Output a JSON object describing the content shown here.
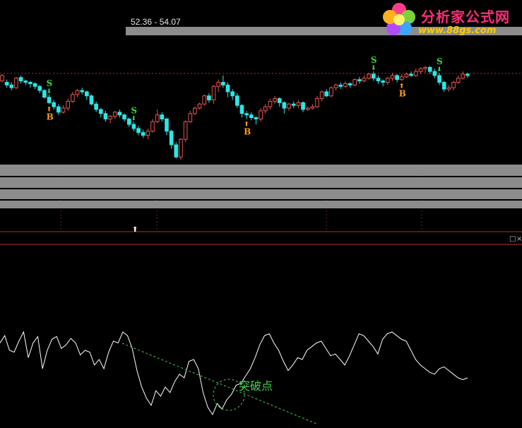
{
  "header": {
    "price_range": "52.36 - 54.07"
  },
  "logo": {
    "title": "分析家公式网",
    "url": "www.88gs.com"
  },
  "annotation": {
    "breakout_label": "突破点"
  },
  "window_buttons": [
    "□",
    "×"
  ],
  "signals": {
    "sell_label": "S",
    "buy_label": "B",
    "sell_color": "#3fd24a",
    "buy_color": "#ff9a1a"
  },
  "colors": {
    "background": "#000000",
    "up": "#e8574f",
    "down": "#2ee6e6",
    "indicator": "#ffffff",
    "trendline": "#3fd24a",
    "separator": "#c0282f",
    "band": "#8c8c8c"
  },
  "chart_data": [
    {
      "type": "candlestick",
      "title": "",
      "xlabel": "",
      "ylabel": "",
      "ylim": [
        0,
        235
      ],
      "grid": false,
      "legend": "none",
      "series": [
        {
          "values": [
            [
              120,
              128,
              118,
              130
            ],
            [
              118,
              114,
              110,
              122
            ],
            [
              114,
              110,
              106,
              118
            ],
            [
              110,
              124,
              108,
              126
            ],
            [
              125,
              120,
              116,
              128
            ],
            [
              120,
              118,
              114,
              122
            ],
            [
              118,
              116,
              110,
              120
            ],
            [
              116,
              112,
              108,
              118
            ],
            [
              112,
              106,
              102,
              114
            ],
            [
              106,
              96,
              94,
              108
            ],
            [
              96,
              88,
              86,
              100
            ],
            [
              88,
              82,
              78,
              92
            ],
            [
              82,
              74,
              70,
              86
            ],
            [
              74,
              80,
              72,
              84
            ],
            [
              80,
              90,
              76,
              94
            ],
            [
              90,
              100,
              88,
              104
            ],
            [
              100,
              106,
              96,
              108
            ],
            [
              106,
              104,
              100,
              110
            ],
            [
              104,
              98,
              92,
              106
            ],
            [
              98,
              86,
              84,
              100
            ],
            [
              86,
              78,
              74,
              90
            ],
            [
              78,
              72,
              66,
              80
            ],
            [
              72,
              64,
              60,
              76
            ],
            [
              64,
              68,
              58,
              70
            ],
            [
              68,
              74,
              64,
              76
            ],
            [
              74,
              70,
              66,
              78
            ],
            [
              70,
              64,
              60,
              72
            ],
            [
              64,
              56,
              52,
              66
            ],
            [
              56,
              50,
              46,
              60
            ],
            [
              50,
              44,
              40,
              54
            ],
            [
              44,
              40,
              36,
              48
            ],
            [
              40,
              46,
              34,
              50
            ],
            [
              46,
              60,
              44,
              64
            ],
            [
              60,
              70,
              58,
              78
            ],
            [
              70,
              64,
              60,
              74
            ],
            [
              64,
              46,
              40,
              66
            ],
            [
              46,
              26,
              20,
              48
            ],
            [
              26,
              8,
              6,
              30
            ],
            [
              8,
              34,
              4,
              36
            ],
            [
              34,
              60,
              30,
              62
            ],
            [
              60,
              72,
              58,
              76
            ],
            [
              72,
              80,
              70,
              82
            ],
            [
              80,
              86,
              78,
              88
            ],
            [
              86,
              98,
              84,
              100
            ],
            [
              98,
              92,
              88,
              102
            ],
            [
              92,
              112,
              86,
              114
            ],
            [
              112,
              118,
              104,
              122
            ],
            [
              118,
              114,
              110,
              128
            ],
            [
              114,
              104,
              96,
              118
            ],
            [
              104,
              98,
              92,
              108
            ],
            [
              98,
              84,
              80,
              102
            ],
            [
              84,
              72,
              66,
              86
            ],
            [
              72,
              70,
              64,
              76
            ],
            [
              70,
              66,
              62,
              74
            ],
            [
              66,
              64,
              56,
              68
            ],
            [
              64,
              76,
              60,
              80
            ],
            [
              76,
              82,
              72,
              86
            ],
            [
              82,
              90,
              78,
              94
            ],
            [
              90,
              94,
              86,
              98
            ],
            [
              94,
              88,
              82,
              96
            ],
            [
              88,
              80,
              72,
              90
            ],
            [
              80,
              86,
              76,
              88
            ],
            [
              86,
              84,
              80,
              90
            ],
            [
              84,
              88,
              80,
              92
            ],
            [
              88,
              78,
              74,
              90
            ],
            [
              78,
              80,
              76,
              82
            ],
            [
              80,
              82,
              78,
              86
            ],
            [
              82,
              94,
              80,
              98
            ],
            [
              94,
              104,
              90,
              106
            ],
            [
              104,
              98,
              96,
              108
            ],
            [
              98,
              110,
              96,
              112
            ],
            [
              110,
              114,
              106,
              116
            ],
            [
              114,
              112,
              108,
              118
            ],
            [
              112,
              116,
              110,
              120
            ],
            [
              116,
              114,
              110,
              118
            ],
            [
              114,
              122,
              112,
              124
            ],
            [
              122,
              120,
              116,
              126
            ],
            [
              120,
              124,
              118,
              128
            ],
            [
              124,
              130,
              122,
              132
            ],
            [
              130,
              124,
              120,
              134
            ],
            [
              124,
              120,
              116,
              128
            ],
            [
              120,
              118,
              112,
              122
            ],
            [
              118,
              124,
              114,
              126
            ],
            [
              124,
              128,
              120,
              132
            ],
            [
              128,
              122,
              118,
              130
            ],
            [
              122,
              126,
              120,
              130
            ],
            [
              126,
              130,
              124,
              132
            ],
            [
              130,
              128,
              126,
              134
            ],
            [
              128,
              134,
              126,
              138
            ],
            [
              134,
              138,
              130,
              140
            ],
            [
              138,
              140,
              132,
              142
            ],
            [
              140,
              134,
              130,
              142
            ],
            [
              134,
              128,
              124,
              138
            ],
            [
              128,
              118,
              114,
              132
            ],
            [
              118,
              108,
              104,
              120
            ],
            [
              108,
              110,
              104,
              114
            ],
            [
              110,
              118,
              106,
              120
            ],
            [
              118,
              124,
              116,
              128
            ],
            [
              124,
              130,
              122,
              134
            ],
            [
              130,
              128,
              124,
              132
            ]
          ]
        }
      ]
    },
    {
      "type": "line",
      "title": "",
      "xlabel": "",
      "ylabel": "",
      "ylim": [
        0,
        1
      ],
      "grid": false,
      "legend": "none",
      "series": [
        {
          "values": [
            0.88,
            0.96,
            0.8,
            0.78,
            0.9,
            1.0,
            0.72,
            0.88,
            0.95,
            0.6,
            0.8,
            0.92,
            0.95,
            0.82,
            0.86,
            0.93,
            0.88,
            0.75,
            0.8,
            0.78,
            0.64,
            0.7,
            0.6,
            0.78,
            0.9,
            0.88,
            1.0,
            0.96,
            0.82,
            0.58,
            0.4,
            0.28,
            0.2,
            0.36,
            0.3,
            0.4,
            0.34,
            0.46,
            0.54,
            0.5,
            0.68,
            0.7,
            0.6,
            0.34,
            0.18,
            0.1,
            0.22,
            0.16,
            0.26,
            0.32,
            0.42,
            0.44,
            0.52,
            0.6,
            0.72,
            0.86,
            0.96,
            0.98,
            0.88,
            0.8,
            0.68,
            0.58,
            0.64,
            0.72,
            0.7,
            0.8,
            0.84,
            0.88,
            0.9,
            0.82,
            0.74,
            0.76,
            0.7,
            0.64,
            0.74,
            0.86,
            0.98,
            0.96,
            0.9,
            0.84,
            0.76,
            0.92,
            0.98,
            1.0,
            0.96,
            0.92,
            0.9,
            0.8,
            0.7,
            0.64,
            0.6,
            0.56,
            0.54,
            0.6,
            0.62,
            0.58,
            0.54,
            0.5,
            0.48,
            0.5
          ]
        }
      ]
    }
  ]
}
